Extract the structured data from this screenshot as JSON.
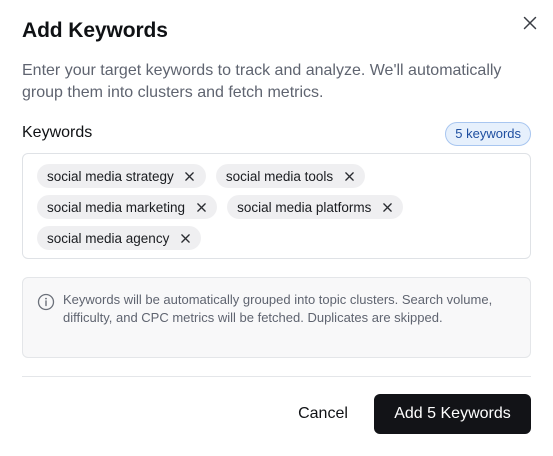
{
  "dialog": {
    "title": "Add Keywords",
    "description": "Enter your target keywords to track and analyze. We'll automatically group them into clusters and fetch metrics."
  },
  "keywords": {
    "label": "Keywords",
    "count_badge": "5 keywords",
    "items": [
      {
        "label": "social media strategy"
      },
      {
        "label": "social media tools"
      },
      {
        "label": "social media marketing"
      },
      {
        "label": "social media platforms"
      },
      {
        "label": "social media agency"
      }
    ]
  },
  "info": {
    "icon": "info-circle-icon",
    "text": "Keywords will be automatically grouped into topic clusters. Search volume, difficulty, and CPC metrics will be fetched. Duplicates are skipped."
  },
  "footer": {
    "cancel_label": "Cancel",
    "submit_label": "Add 5 Keywords"
  },
  "colors": {
    "primary_button": "#121317",
    "badge_bg": "#e6f0fc",
    "badge_border": "#a8c6f0",
    "badge_text": "#1f4fa0",
    "chip_bg": "#efeff1"
  }
}
